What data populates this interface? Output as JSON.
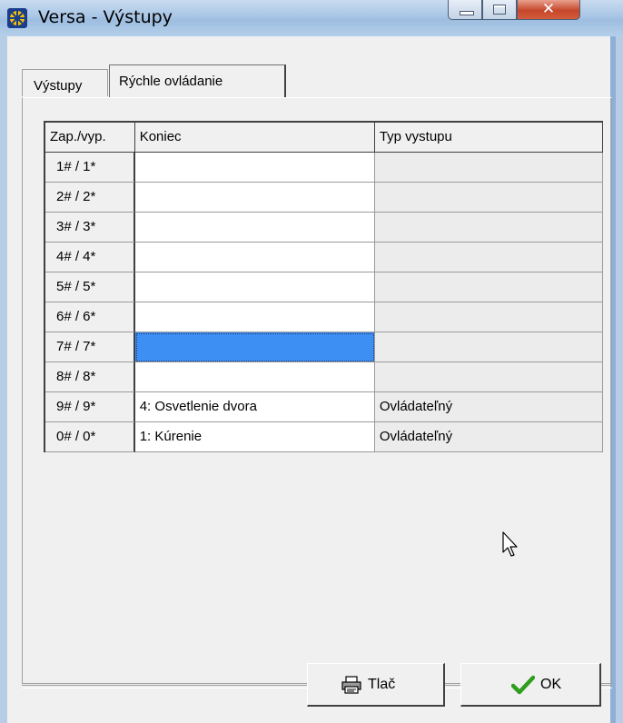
{
  "window": {
    "title": "Versa - Výstupy"
  },
  "tabs": [
    {
      "label": "Výstupy"
    },
    {
      "label": "Rýchle ovládanie"
    }
  ],
  "grid": {
    "headers": [
      "Zap./vyp.",
      "Koniec",
      "Typ vystupu"
    ],
    "rows": [
      {
        "key": "1# / 1*",
        "koniec": "",
        "typ": ""
      },
      {
        "key": "2# / 2*",
        "koniec": "",
        "typ": ""
      },
      {
        "key": "3# / 3*",
        "koniec": "",
        "typ": ""
      },
      {
        "key": "4# / 4*",
        "koniec": "",
        "typ": ""
      },
      {
        "key": "5# / 5*",
        "koniec": "",
        "typ": ""
      },
      {
        "key": "6# / 6*",
        "koniec": "",
        "typ": ""
      },
      {
        "key": "7# / 7*",
        "koniec": "",
        "typ": ""
      },
      {
        "key": "8# / 8*",
        "koniec": "",
        "typ": ""
      },
      {
        "key": "9# / 9*",
        "koniec": "4: Osvetlenie dvora",
        "typ": "Ovládateľný"
      },
      {
        "key": "0# / 0*",
        "koniec": "1: Kúrenie",
        "typ": "Ovládateľný"
      }
    ]
  },
  "buttons": {
    "print_label": "Tlač",
    "ok_label": "OK"
  },
  "colors": {
    "selection": "#3d8ff3",
    "ok_check": "#2f9e1e"
  }
}
